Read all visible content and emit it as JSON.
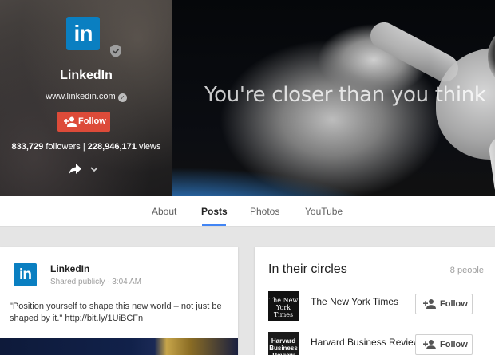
{
  "profile": {
    "logo_text": "in",
    "name": "LinkedIn",
    "website": "www.linkedin.com",
    "follow_label": "Follow",
    "followers_count": "833,729",
    "followers_label": "followers",
    "separator": "|",
    "views_count": "228,946,171",
    "views_label": "views"
  },
  "cover": {
    "tagline": "You're closer than you think"
  },
  "tabs": [
    {
      "label": "About"
    },
    {
      "label": "Posts",
      "active": true
    },
    {
      "label": "Photos"
    },
    {
      "label": "YouTube"
    }
  ],
  "post": {
    "logo_text": "in",
    "author": "LinkedIn",
    "visibility": "Shared publicly",
    "dot": "·",
    "time": "3:04 AM",
    "text": "\"Position yourself to shape this new world – not just be shaped by it.\" http://bit.ly/1UiBCFn"
  },
  "circles": {
    "title": "In their circles",
    "count": "8 people",
    "items": [
      {
        "name": "The New York Times",
        "avatar_text": "The New York Times",
        "follow_label": "Follow"
      },
      {
        "name": "Harvard Business Review",
        "avatar_text": "Harvard Business Review",
        "follow_label": "Follow"
      }
    ]
  },
  "colors": {
    "linkedin_blue": "#0a7fc1",
    "follow_red": "#dd4b39",
    "tab_accent": "#4285f4"
  }
}
